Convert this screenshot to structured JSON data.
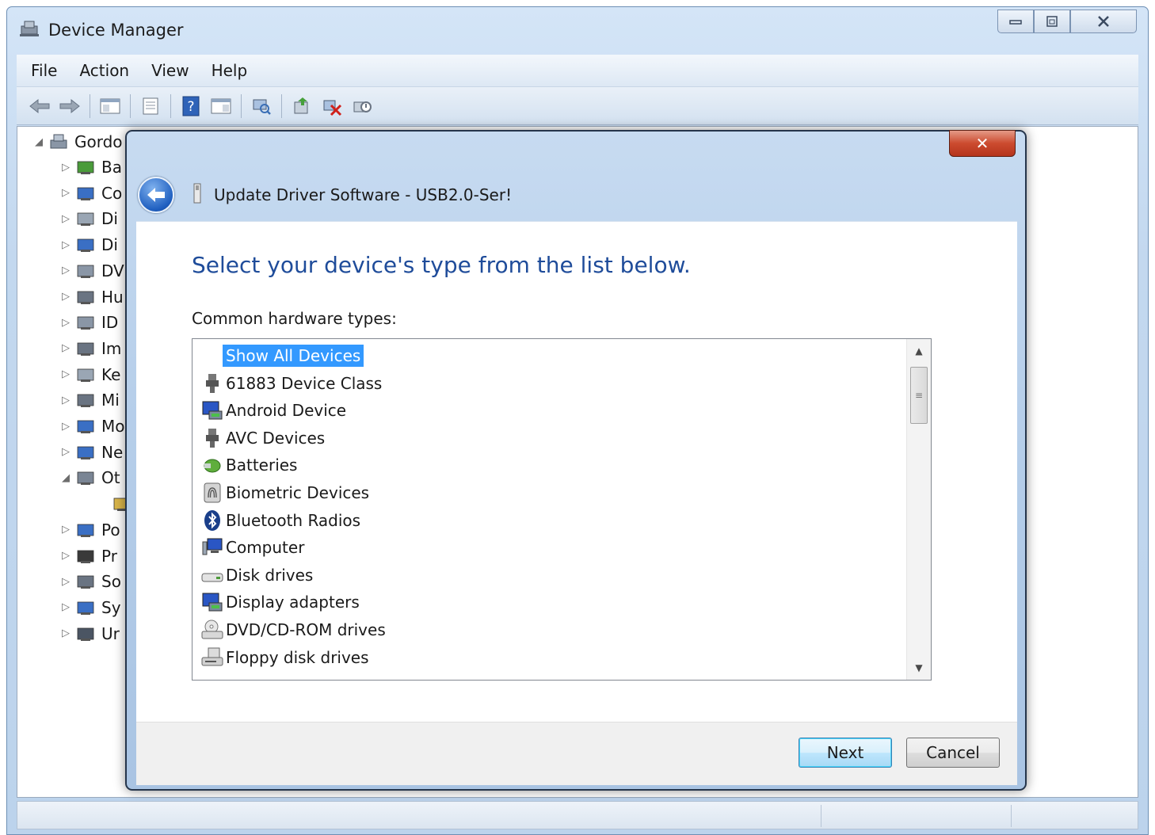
{
  "window": {
    "title": "Device Manager",
    "caption_buttons": [
      "minimize",
      "restore",
      "close"
    ]
  },
  "menu": [
    "File",
    "Action",
    "View",
    "Help"
  ],
  "toolbar_icons": [
    "back-icon",
    "forward-icon",
    "show-hide-tree-icon",
    "properties-icon",
    "help-icon",
    "action-pane-icon",
    "scan-hardware-icon",
    "update-driver-icon",
    "uninstall-icon",
    "disable-icon"
  ],
  "tree": {
    "root": "Gordo",
    "items": [
      "Ba",
      "Co",
      "Di",
      "Di",
      "DV",
      "Hu",
      "ID",
      "Im",
      "Ke",
      "Mi",
      "Mo",
      "Ne",
      "Ot",
      "",
      "Po",
      "Pr",
      "So",
      "Sy",
      "Ur"
    ]
  },
  "dialog": {
    "title": "Update Driver Software - USB2.0-Ser!",
    "close_label": "✕",
    "heading": "Select your device's type from the list below.",
    "list_label": "Common hardware types:",
    "items": [
      {
        "label": "Show All Devices",
        "icon": "none",
        "selected": true
      },
      {
        "label": "61883 Device Class",
        "icon": "usb-plug-icon"
      },
      {
        "label": "Android Device",
        "icon": "display-adapter-icon"
      },
      {
        "label": "AVC Devices",
        "icon": "usb-plug-icon"
      },
      {
        "label": "Batteries",
        "icon": "battery-icon"
      },
      {
        "label": "Biometric Devices",
        "icon": "fingerprint-icon"
      },
      {
        "label": "Bluetooth Radios",
        "icon": "bluetooth-icon"
      },
      {
        "label": "Computer",
        "icon": "computer-icon"
      },
      {
        "label": "Disk drives",
        "icon": "disk-drive-icon"
      },
      {
        "label": "Display adapters",
        "icon": "display-adapter-icon"
      },
      {
        "label": "DVD/CD-ROM drives",
        "icon": "dvd-drive-icon"
      },
      {
        "label": "Floppy disk drives",
        "icon": "floppy-drive-icon"
      }
    ],
    "buttons": {
      "next": "Next",
      "cancel": "Cancel"
    }
  }
}
